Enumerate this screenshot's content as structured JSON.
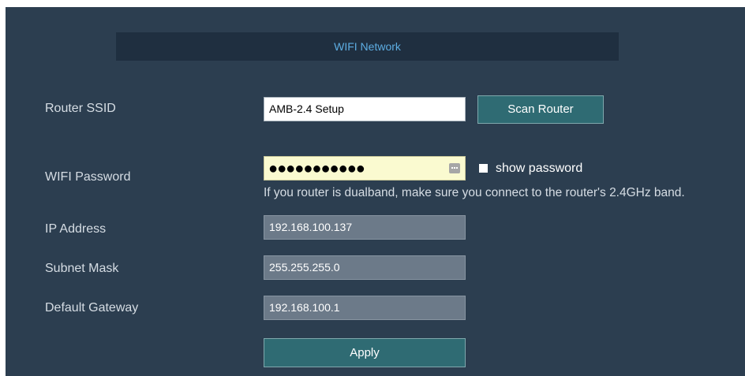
{
  "section": {
    "title": "WIFI Network"
  },
  "ssid": {
    "label": "Router SSID",
    "value": "AMB-2.4 Setup",
    "scan_button": "Scan Router"
  },
  "password": {
    "label": "WIFI Password",
    "masked_value": "●●●●●●●●●●●",
    "show_password_label": "show password",
    "hint": "If you router is dualband, make sure you connect to the router's 2.4GHz band."
  },
  "ip": {
    "label": "IP Address",
    "value": "192.168.100.137"
  },
  "subnet": {
    "label": "Subnet Mask",
    "value": "255.255.255.0"
  },
  "gateway": {
    "label": "Default Gateway",
    "value": "192.168.100.1"
  },
  "apply_button": "Apply"
}
